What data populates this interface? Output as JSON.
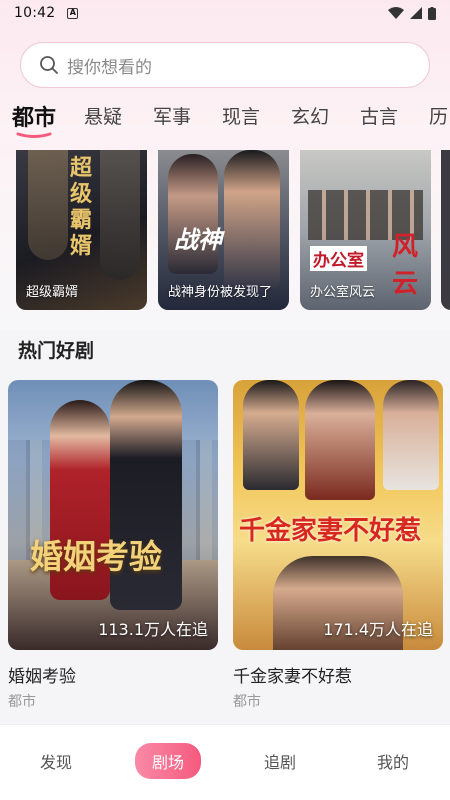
{
  "status_bar": {
    "time": "10:42",
    "notif_badge": "A"
  },
  "search": {
    "placeholder": "搜你想看的"
  },
  "category_tabs": [
    "都市",
    "悬疑",
    "军事",
    "现言",
    "玄幻",
    "古言",
    "历"
  ],
  "active_tab_index": 0,
  "accent_color": "#f55a7e",
  "rail": {
    "items": [
      {
        "title": "超级霸婿",
        "poster_text": "超级霸婿"
      },
      {
        "title": "战神身份被发现了",
        "poster_text": "战神"
      },
      {
        "title": "办公室风云",
        "poster_text_1": "办公室",
        "poster_text_2": "风云"
      }
    ]
  },
  "hot_section": {
    "title": "热门好剧",
    "items": [
      {
        "title": "婚姻考验",
        "genre": "都市",
        "followers": "113.1万人在追",
        "poster_text": "婚姻考验"
      },
      {
        "title": "千金家妻不好惹",
        "genre": "都市",
        "followers": "171.4万人在追",
        "poster_text": "千金家妻不好惹"
      }
    ]
  },
  "bottom_nav": {
    "items": [
      "发现",
      "剧场",
      "追剧",
      "我的"
    ],
    "active_index": 1
  }
}
